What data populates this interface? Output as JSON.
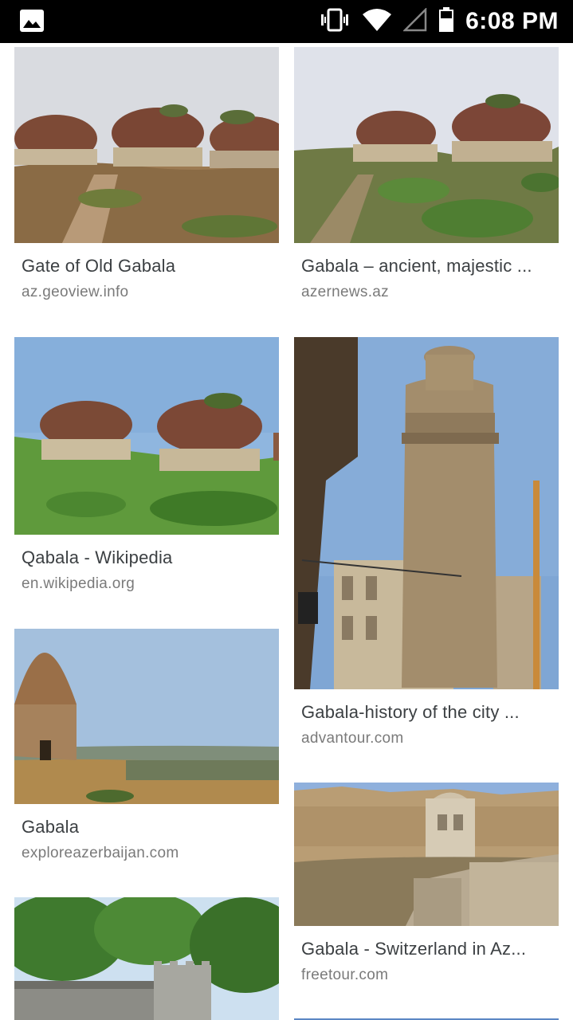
{
  "status_bar": {
    "time": "6:08 PM",
    "left_icon": "image-notification-icon",
    "icons": [
      "vibrate-icon",
      "wifi-icon",
      "signal-icon",
      "battery-icon"
    ]
  },
  "results": [
    {
      "title": "Gate of Old Gabala",
      "source": "az.geoview.info"
    },
    {
      "title": "Gabala – ancient, majestic ...",
      "source": "azernews.az"
    },
    {
      "title": "Qabala - Wikipedia",
      "source": "en.wikipedia.org"
    },
    {
      "title": "Gabala-history of the city ...",
      "source": "advantour.com"
    },
    {
      "title": "Gabala",
      "source": "exploreazerbaijan.com"
    },
    {
      "title": "Gabala - Switzerland in Az...",
      "source": "freetour.com"
    },
    {
      "title": "",
      "source": ""
    }
  ]
}
